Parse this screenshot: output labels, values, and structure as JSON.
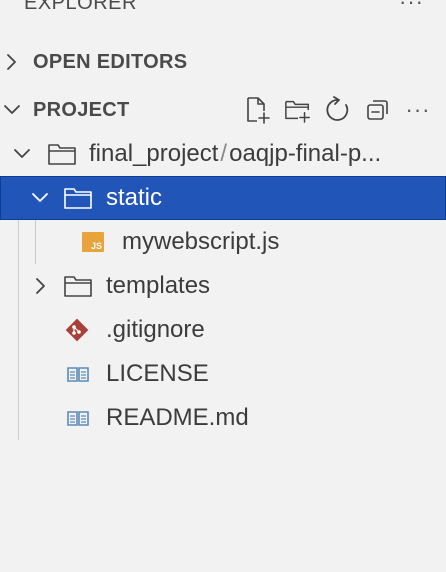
{
  "header": {
    "title": "EXPLORER",
    "more_label": "···"
  },
  "open_editors": {
    "title": "OPEN EDITORS",
    "expanded": false
  },
  "project": {
    "title": "PROJECT",
    "expanded": true,
    "actions": [
      {
        "name": "new-file-icon"
      },
      {
        "name": "new-folder-icon"
      },
      {
        "name": "refresh-icon"
      },
      {
        "name": "collapse-all-icon"
      },
      {
        "name": "more-actions-icon",
        "label": "···"
      }
    ]
  },
  "tree": {
    "root": {
      "name": "final_project",
      "separator": "/",
      "sub": "oaqjp-final-p..."
    },
    "items": [
      {
        "label": "static",
        "type": "folder",
        "expanded": true,
        "selected": true
      },
      {
        "label": "mywebscript.js",
        "type": "js-file",
        "badge": "JS"
      },
      {
        "label": "templates",
        "type": "folder",
        "expanded": false
      },
      {
        "label": ".gitignore",
        "type": "git-file"
      },
      {
        "label": "LICENSE",
        "type": "doc-file"
      },
      {
        "label": "README.md",
        "type": "doc-file"
      }
    ]
  },
  "colors": {
    "selection": "#2156b8",
    "background": "#f2f2f2",
    "js_badge": "#e8a33c",
    "git_icon": "#a8413a",
    "doc_icon": "#5b8bb8"
  }
}
